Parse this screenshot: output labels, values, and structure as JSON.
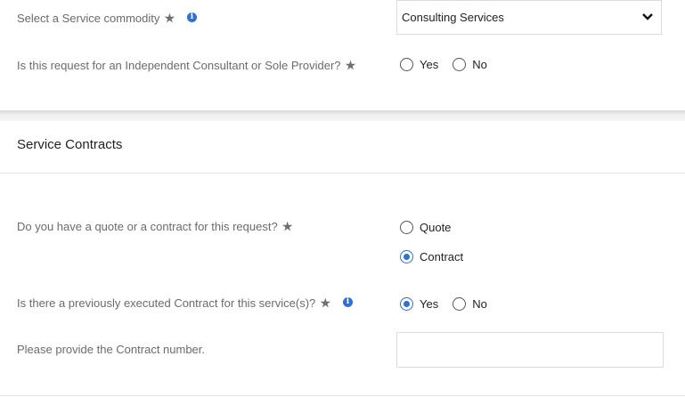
{
  "commodity": {
    "label": "Select a Service commodity",
    "selected": "Consulting Services"
  },
  "independent_consultant": {
    "label": "Is this request for an Independent Consultant or Sole Provider?",
    "options": [
      "Yes",
      "No"
    ]
  },
  "section": {
    "title": "Service Contracts"
  },
  "quote_or_contract": {
    "label": "Do you have a quote or a contract for this request?",
    "options": [
      "Quote",
      "Contract"
    ],
    "selected": "Contract"
  },
  "previous_contract": {
    "label": "Is there a previously executed Contract for this service(s)?",
    "options": [
      "Yes",
      "No"
    ],
    "selected": "Yes"
  },
  "contract_number": {
    "label": "Please provide the Contract number.",
    "value": ""
  },
  "colors": {
    "accent": "#2f6fd6",
    "label_text": "#6b6b6b"
  }
}
